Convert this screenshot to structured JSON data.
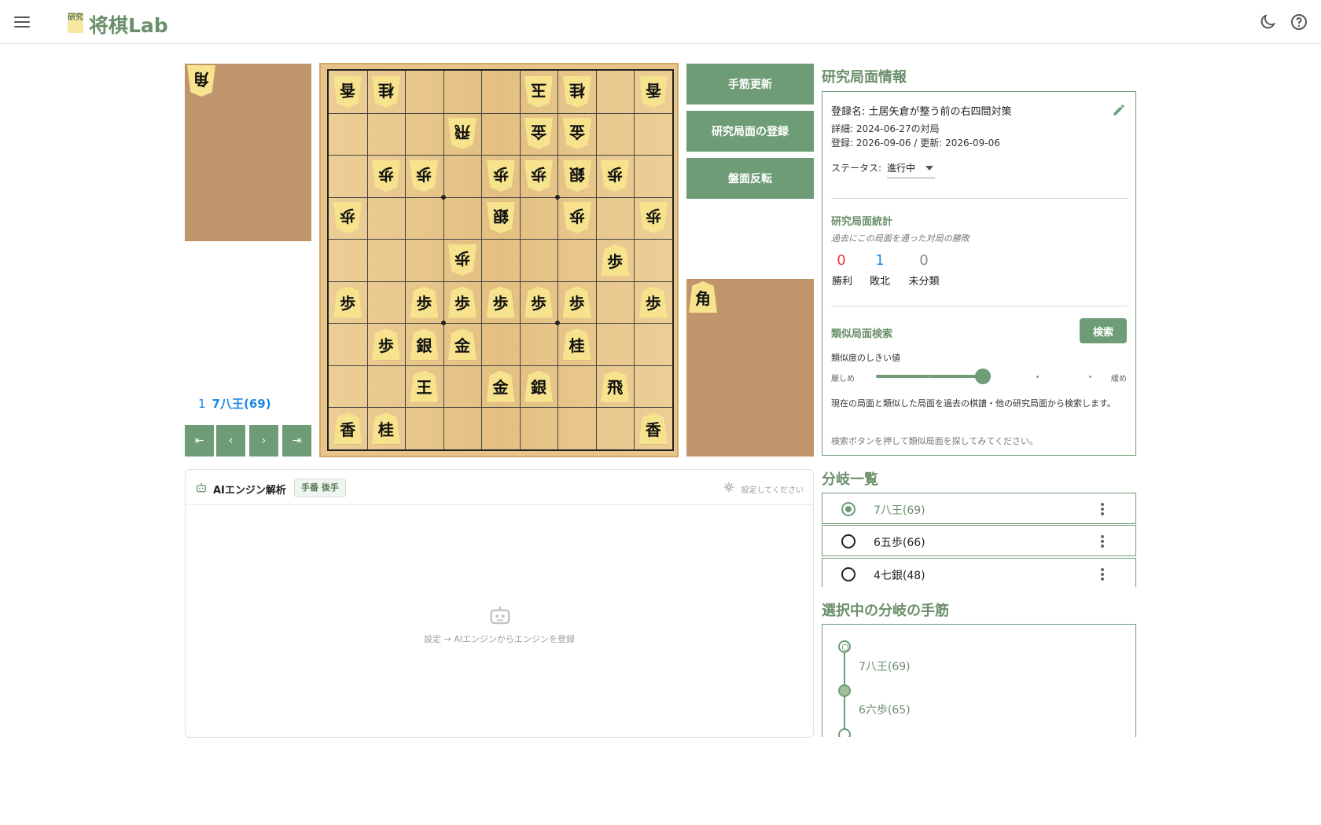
{
  "header": {
    "logo_text": "研究",
    "app_title": "将棋Lab"
  },
  "board": {
    "pieces": [
      {
        "f": 9,
        "r": 1,
        "c": "香",
        "side": "gote"
      },
      {
        "f": 8,
        "r": 1,
        "c": "桂",
        "side": "gote"
      },
      {
        "f": 4,
        "r": 1,
        "c": "玉",
        "side": "gote"
      },
      {
        "f": 3,
        "r": 1,
        "c": "桂",
        "side": "gote"
      },
      {
        "f": 1,
        "r": 1,
        "c": "香",
        "side": "gote"
      },
      {
        "f": 6,
        "r": 2,
        "c": "飛",
        "side": "gote"
      },
      {
        "f": 4,
        "r": 2,
        "c": "金",
        "side": "gote"
      },
      {
        "f": 3,
        "r": 2,
        "c": "金",
        "side": "gote"
      },
      {
        "f": 8,
        "r": 3,
        "c": "歩",
        "side": "gote"
      },
      {
        "f": 7,
        "r": 3,
        "c": "歩",
        "side": "gote"
      },
      {
        "f": 5,
        "r": 3,
        "c": "歩",
        "side": "gote"
      },
      {
        "f": 4,
        "r": 3,
        "c": "歩",
        "side": "gote"
      },
      {
        "f": 3,
        "r": 3,
        "c": "銀",
        "side": "gote"
      },
      {
        "f": 2,
        "r": 3,
        "c": "歩",
        "side": "gote"
      },
      {
        "f": 9,
        "r": 4,
        "c": "歩",
        "side": "gote"
      },
      {
        "f": 5,
        "r": 4,
        "c": "銀",
        "side": "gote"
      },
      {
        "f": 3,
        "r": 4,
        "c": "歩",
        "side": "gote"
      },
      {
        "f": 1,
        "r": 4,
        "c": "歩",
        "side": "gote"
      },
      {
        "f": 6,
        "r": 5,
        "c": "歩",
        "side": "gote"
      },
      {
        "f": 2,
        "r": 5,
        "c": "歩",
        "side": "sente"
      },
      {
        "f": 9,
        "r": 6,
        "c": "歩",
        "side": "sente"
      },
      {
        "f": 7,
        "r": 6,
        "c": "歩",
        "side": "sente"
      },
      {
        "f": 6,
        "r": 6,
        "c": "歩",
        "side": "sente"
      },
      {
        "f": 5,
        "r": 6,
        "c": "歩",
        "side": "sente"
      },
      {
        "f": 4,
        "r": 6,
        "c": "歩",
        "side": "sente"
      },
      {
        "f": 3,
        "r": 6,
        "c": "歩",
        "side": "sente"
      },
      {
        "f": 1,
        "r": 6,
        "c": "歩",
        "side": "sente"
      },
      {
        "f": 8,
        "r": 7,
        "c": "歩",
        "side": "sente"
      },
      {
        "f": 7,
        "r": 7,
        "c": "銀",
        "side": "sente"
      },
      {
        "f": 6,
        "r": 7,
        "c": "金",
        "side": "sente"
      },
      {
        "f": 3,
        "r": 7,
        "c": "桂",
        "side": "sente"
      },
      {
        "f": 7,
        "r": 8,
        "c": "王",
        "side": "sente"
      },
      {
        "f": 5,
        "r": 8,
        "c": "金",
        "side": "sente"
      },
      {
        "f": 4,
        "r": 8,
        "c": "銀",
        "side": "sente"
      },
      {
        "f": 2,
        "r": 8,
        "c": "飛",
        "side": "sente"
      },
      {
        "f": 9,
        "r": 9,
        "c": "香",
        "side": "sente"
      },
      {
        "f": 8,
        "r": 9,
        "c": "桂",
        "side": "sente"
      },
      {
        "f": 1,
        "r": 9,
        "c": "香",
        "side": "sente"
      }
    ],
    "hand_gote": [
      "角"
    ],
    "hand_sente": [
      "角"
    ]
  },
  "move_display": {
    "number": "1",
    "move": "7八王(69)"
  },
  "nav": {
    "first": "⇤",
    "prev": "‹",
    "next": "›",
    "last": "⇥"
  },
  "actions": {
    "update_moves": "手筋更新",
    "register_position": "研究局面の登録",
    "flip_board": "盤面反転"
  },
  "info": {
    "section_title": "研究局面情報",
    "name": "登録名: 土居矢倉が整う前の右四間対策",
    "detail": "詳細: 2024-06-27の対局",
    "dates": "登録: 2026-09-06 / 更新: 2026-09-06",
    "status_label": "ステータス:",
    "status_value": "進行中",
    "stats_title": "研究局面統計",
    "stats_note": "過去にこの局面を通った対局の勝敗",
    "wins": "0",
    "wins_label": "勝利",
    "losses": "1",
    "losses_label": "敗北",
    "unclassified": "0",
    "unclassified_label": "未分類",
    "similar_title": "類似局面検索",
    "search_button": "検索",
    "threshold_label": "類似度のしきい値",
    "strict_label": "厳しめ",
    "loose_label": "緩め",
    "threshold_value": 0.45,
    "similar_desc": "現在の局面と類似した局面を過去の棋譜・他の研究局面から検索します。",
    "similar_hint": "検索ボタンを押して類似局面を探してみてください。"
  },
  "branches": {
    "title": "分岐一覧",
    "items": [
      {
        "label": "7八王(69)",
        "selected": true
      },
      {
        "label": "6五歩(66)",
        "selected": false
      },
      {
        "label": "4七銀(48)",
        "selected": false
      }
    ]
  },
  "selected_branch": {
    "title": "選択中の分岐の手筋",
    "moves": [
      "7八王(69)",
      "6六歩(65)"
    ]
  },
  "ai": {
    "title": "AIエンジン解析",
    "badge": "手番 後手",
    "setting_hint": "設定してください",
    "empty_message": "設定 → AIエンジンからエンジンを登録"
  },
  "colors": {
    "accent": "#6e9c76",
    "win": "#e53935",
    "loss": "#1e88e5",
    "neutral": "#888888"
  }
}
